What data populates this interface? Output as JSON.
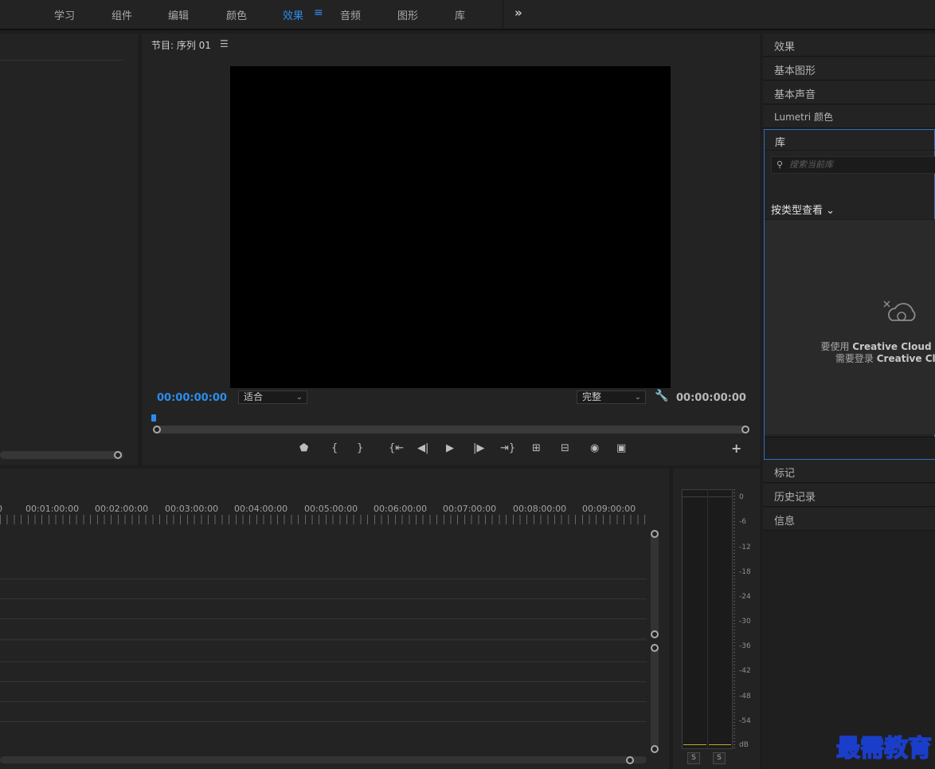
{
  "workspaces": {
    "items": [
      {
        "label": "学习"
      },
      {
        "label": "组件"
      },
      {
        "label": "编辑"
      },
      {
        "label": "颜色"
      },
      {
        "label": "效果",
        "active": true
      },
      {
        "label": "音频"
      },
      {
        "label": "图形"
      },
      {
        "label": "库"
      }
    ],
    "more_icon": "double-chevron-right-icon",
    "menu_icon": "hamburger-menu-icon"
  },
  "program_monitor": {
    "title": "节目: 序列 01",
    "menu_glyph": "☰",
    "timecode_in": "00:00:00:00",
    "timecode_out": "00:00:00:00",
    "fit": "适合",
    "quality": "完整"
  },
  "right_panel": {
    "items_top": [
      "效果",
      "基本图形",
      "基本声音",
      "Lumetri 颜色"
    ],
    "library": {
      "title": "库",
      "search_placeholder": "搜索当前库",
      "view_by": "按类型查看",
      "message_prefix_1": "要使用",
      "message_brand_1": "Creative Cloud Libr",
      "message_prefix_2": "需要登录",
      "message_brand_2": "Creative Cloud"
    },
    "items_bottom": [
      "标记",
      "历史记录",
      "信息"
    ]
  },
  "timeline": {
    "ruler_labels": [
      "0",
      "00:01:00:00",
      "00:02:00:00",
      "00:03:00:00",
      "00:04:00:00",
      "00:05:00:00",
      "00:06:00:00",
      "00:07:00:00",
      "00:08:00:00",
      "00:09:00:00"
    ]
  },
  "audio_meter": {
    "db_labels": [
      "0",
      "-6",
      "-12",
      "-18",
      "-24",
      "-30",
      "-36",
      "-42",
      "-48",
      "-54",
      "dB"
    ],
    "solo_labels": [
      "S",
      "S"
    ]
  },
  "watermark": "最需教育",
  "colors": {
    "accent": "#2d8ceb",
    "panel": "#232323",
    "background": "#1d1d1d"
  }
}
